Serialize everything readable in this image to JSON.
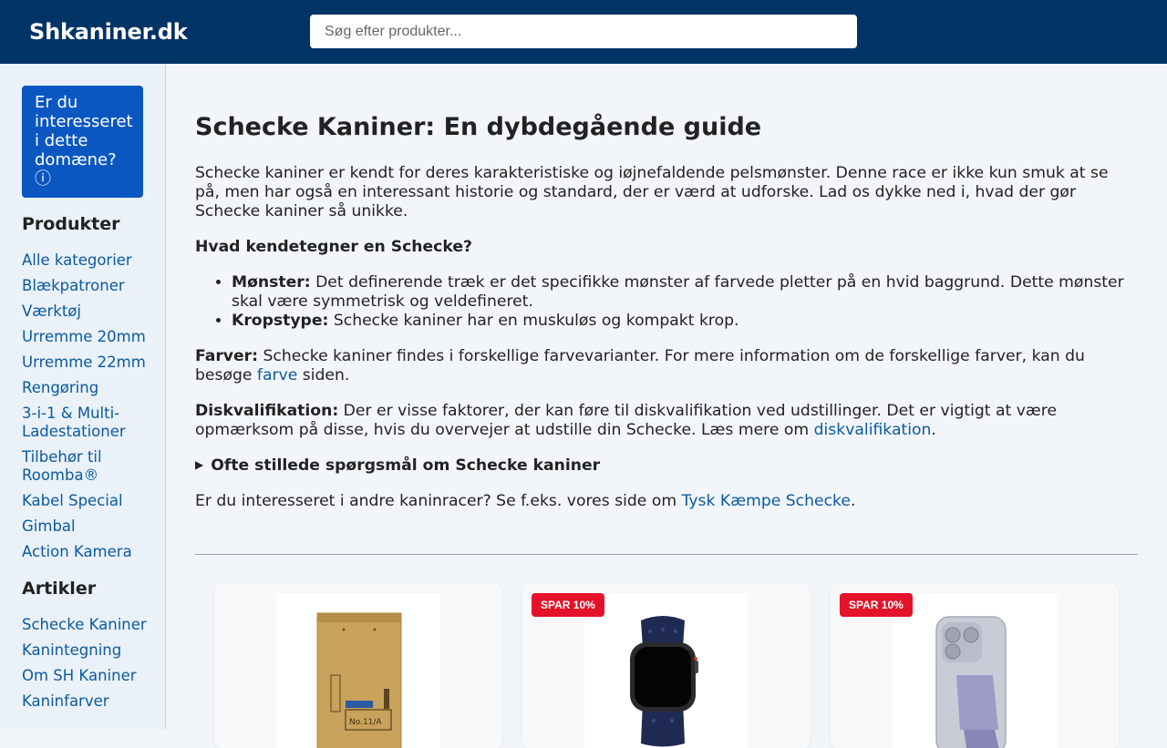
{
  "header": {
    "logo": "Shkaniner.dk",
    "search_placeholder": "Søg efter produkter..."
  },
  "sidebar": {
    "domain_box": "Er du interesseret i dette domæne? ⓘ",
    "products_heading": "Produkter",
    "products": [
      "Alle kategorier",
      "Blækpatroner",
      "Værktøj",
      "Urremme 20mm",
      "Urremme 22mm",
      "Rengøring",
      "3-i-1 & Multi-Ladestationer",
      "Tilbehør til Roomba®",
      "Kabel Special",
      "Gimbal",
      "Action Kamera"
    ],
    "articles_heading": "Artikler",
    "articles": [
      "Schecke Kaniner",
      "Kanintegning",
      "Om SH Kaniner",
      "Kaninfarver"
    ]
  },
  "main": {
    "title": "Schecke Kaniner: En dybdegående guide",
    "intro": "Schecke kaniner er kendt for deres karakteristiske og iøjnefaldende pelsmønster. Denne race er ikke kun smuk at se på, men har også en interessant historie og standard, der er værd at udforske. Lad os dykke ned i, hvad der gør Schecke kaniner så unikke.",
    "question_heading": "Hvad kendetegner en Schecke?",
    "bullets": [
      {
        "label": "Mønster:",
        "text": " Det definerende træk er det specifikke mønster af farvede pletter på en hvid baggrund. Dette mønster skal være symmetrisk og veldefineret."
      },
      {
        "label": "Kropstype:",
        "text": " Schecke kaniner har en muskuløs og kompakt krop."
      }
    ],
    "farver": {
      "label": "Farver:",
      "text": " Schecke kaniner findes i forskellige farvevarianter. For mere information om de forskellige farver, kan du besøge ",
      "link": "farve",
      "after": " siden."
    },
    "disk": {
      "label": "Diskvalifikation:",
      "text": " Der er visse faktorer, der kan føre til diskvalifikation ved udstillinger. Det er vigtigt at være opmærksom på disse, hvis du overvejer at udstille din Schecke. Læs mere om ",
      "link": "diskvalifikation",
      "after": "."
    },
    "faq": "Ofte stillede spørgsmål om Schecke kaniner",
    "other": {
      "text": "Er du interesseret i andre kaninracer? Se f.eks. vores side om ",
      "link": "Tysk Kæmpe Schecke",
      "after": "."
    }
  },
  "products": [
    {
      "badge": "",
      "icon": "padded-envelope-image"
    },
    {
      "badge": "SPAR 10%",
      "icon": "smartwatch-image"
    },
    {
      "badge": "SPAR 10%",
      "icon": "phone-stand-image"
    }
  ],
  "colors": {
    "header_bg": "#003366",
    "link": "#0b5aa0",
    "domain_box": "#0a57c2",
    "badge": "#e4122a"
  }
}
